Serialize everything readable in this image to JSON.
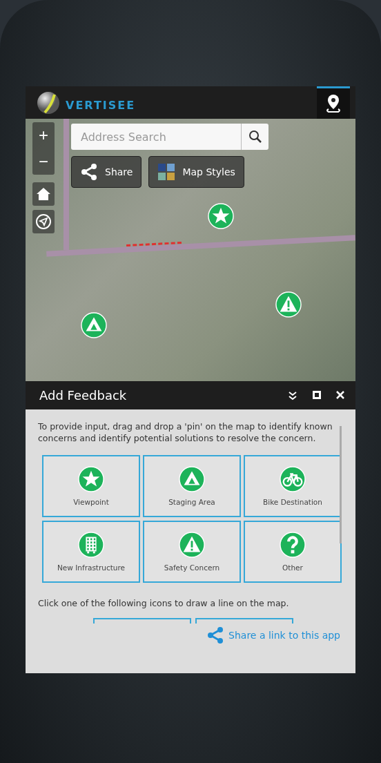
{
  "header": {
    "logo_text": "VERTISEE",
    "tabs": [
      {
        "kind": "pin",
        "selected": true
      }
    ]
  },
  "map": {
    "search": {
      "placeholder": "Address Search"
    },
    "zoom": {
      "in": "+",
      "out": "−"
    },
    "buttons": [
      {
        "kind": "share",
        "label": "Share"
      },
      {
        "kind": "styles",
        "label": "Map Styles"
      }
    ],
    "markers": [
      {
        "kind": "star"
      },
      {
        "kind": "warning"
      },
      {
        "kind": "tent"
      }
    ]
  },
  "panel": {
    "title": "Add Feedback",
    "intro": "To provide input, drag and drop a 'pin' on the map to identify known concerns and identify potential solutions to resolve the concern.",
    "items": [
      {
        "kind": "star",
        "label": "Viewpoint"
      },
      {
        "kind": "tent",
        "label": "Staging Area"
      },
      {
        "kind": "bike",
        "label": "Bike Destination"
      },
      {
        "kind": "building",
        "label": "New Infrastructure"
      },
      {
        "kind": "warning",
        "label": "Safety Concern"
      },
      {
        "kind": "question",
        "label": "Other"
      }
    ],
    "line_instruction": "Click one of the following icons to draw a line on the map.",
    "share_link": "Share a link to this app"
  }
}
